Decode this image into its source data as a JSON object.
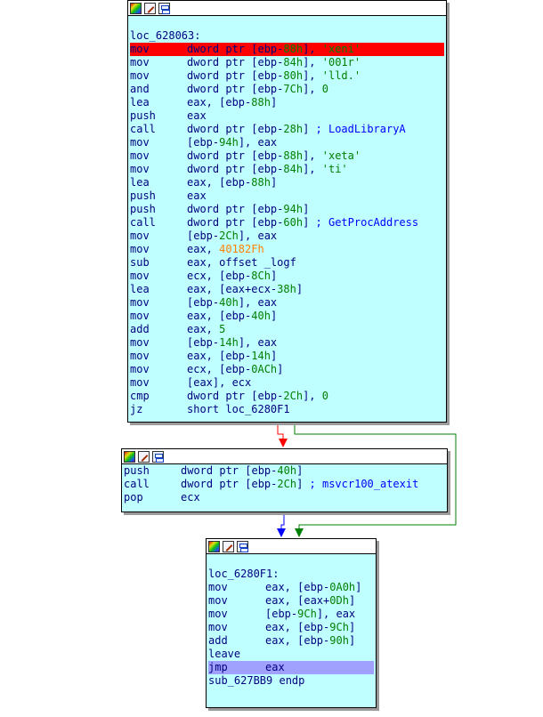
{
  "colors": {
    "node_bg": "#c0ffff",
    "highlight_current": "#ff0000",
    "highlight_selected": "#a0a0ff",
    "edge_true": "#008000",
    "edge_false": "#ff0000",
    "edge_uncond": "#0000ff",
    "immediate": "#ff8000"
  },
  "nodes": [
    {
      "id": "block-1",
      "header_icons": [
        "color-icon",
        "edit-icon",
        "graph-icon"
      ],
      "lines": [
        {
          "kind": "blank"
        },
        {
          "kind": "label",
          "text": "loc_628063:"
        },
        {
          "kind": "ins",
          "hl": "red",
          "mn": "mov",
          "ops": [
            {
              "t": "dword ptr [ebp-",
              "c": "n"
            },
            {
              "t": "88h",
              "c": "var"
            },
            {
              "t": "], ",
              "c": "n"
            },
            {
              "t": "'xeni'",
              "c": "str"
            }
          ]
        },
        {
          "kind": "ins",
          "mn": "mov",
          "ops": [
            {
              "t": "dword ptr [ebp-",
              "c": "n"
            },
            {
              "t": "84h",
              "c": "var"
            },
            {
              "t": "], ",
              "c": "n"
            },
            {
              "t": "'001r'",
              "c": "str"
            }
          ]
        },
        {
          "kind": "ins",
          "mn": "mov",
          "ops": [
            {
              "t": "dword ptr [ebp-",
              "c": "n"
            },
            {
              "t": "80h",
              "c": "var"
            },
            {
              "t": "], ",
              "c": "n"
            },
            {
              "t": "'lld.'",
              "c": "str"
            }
          ]
        },
        {
          "kind": "ins",
          "mn": "and",
          "ops": [
            {
              "t": "dword ptr [ebp-",
              "c": "n"
            },
            {
              "t": "7Ch",
              "c": "var"
            },
            {
              "t": "], ",
              "c": "n"
            },
            {
              "t": "0",
              "c": "num"
            }
          ]
        },
        {
          "kind": "ins",
          "mn": "lea",
          "ops": [
            {
              "t": "eax, [ebp-",
              "c": "n"
            },
            {
              "t": "88h",
              "c": "var"
            },
            {
              "t": "]",
              "c": "n"
            }
          ]
        },
        {
          "kind": "ins",
          "mn": "push",
          "ops": [
            {
              "t": "eax",
              "c": "n"
            }
          ]
        },
        {
          "kind": "ins",
          "mn": "call",
          "ops": [
            {
              "t": "dword ptr [ebp-",
              "c": "n"
            },
            {
              "t": "28h",
              "c": "var"
            },
            {
              "t": "] ",
              "c": "n"
            },
            {
              "t": "; LoadLibraryA",
              "c": "cmt"
            }
          ]
        },
        {
          "kind": "ins",
          "mn": "mov",
          "ops": [
            {
              "t": "[ebp-",
              "c": "n"
            },
            {
              "t": "94h",
              "c": "var"
            },
            {
              "t": "], eax",
              "c": "n"
            }
          ]
        },
        {
          "kind": "ins",
          "mn": "mov",
          "ops": [
            {
              "t": "dword ptr [ebp-",
              "c": "n"
            },
            {
              "t": "88h",
              "c": "var"
            },
            {
              "t": "], ",
              "c": "n"
            },
            {
              "t": "'xeta'",
              "c": "str"
            }
          ]
        },
        {
          "kind": "ins",
          "mn": "mov",
          "ops": [
            {
              "t": "dword ptr [ebp-",
              "c": "n"
            },
            {
              "t": "84h",
              "c": "var"
            },
            {
              "t": "], ",
              "c": "n"
            },
            {
              "t": "'ti'",
              "c": "str"
            }
          ]
        },
        {
          "kind": "ins",
          "mn": "lea",
          "ops": [
            {
              "t": "eax, [ebp-",
              "c": "n"
            },
            {
              "t": "88h",
              "c": "var"
            },
            {
              "t": "]",
              "c": "n"
            }
          ]
        },
        {
          "kind": "ins",
          "mn": "push",
          "ops": [
            {
              "t": "eax",
              "c": "n"
            }
          ]
        },
        {
          "kind": "ins",
          "mn": "push",
          "ops": [
            {
              "t": "dword ptr [ebp-",
              "c": "n"
            },
            {
              "t": "94h",
              "c": "var"
            },
            {
              "t": "]",
              "c": "n"
            }
          ]
        },
        {
          "kind": "ins",
          "mn": "call",
          "ops": [
            {
              "t": "dword ptr [ebp-",
              "c": "n"
            },
            {
              "t": "60h",
              "c": "var"
            },
            {
              "t": "] ",
              "c": "n"
            },
            {
              "t": "; GetProcAddress",
              "c": "cmt"
            }
          ]
        },
        {
          "kind": "ins",
          "mn": "mov",
          "ops": [
            {
              "t": "[ebp-",
              "c": "n"
            },
            {
              "t": "2Ch",
              "c": "var"
            },
            {
              "t": "], eax",
              "c": "n"
            }
          ]
        },
        {
          "kind": "ins",
          "mn": "mov",
          "ops": [
            {
              "t": "eax, ",
              "c": "n"
            },
            {
              "t": "40182Fh",
              "c": "imm"
            }
          ]
        },
        {
          "kind": "ins",
          "mn": "sub",
          "ops": [
            {
              "t": "eax, offset _logf",
              "c": "n"
            }
          ]
        },
        {
          "kind": "ins",
          "mn": "mov",
          "ops": [
            {
              "t": "ecx, [ebp-",
              "c": "n"
            },
            {
              "t": "8Ch",
              "c": "var"
            },
            {
              "t": "]",
              "c": "n"
            }
          ]
        },
        {
          "kind": "ins",
          "mn": "lea",
          "ops": [
            {
              "t": "eax, [eax+ecx-",
              "c": "n"
            },
            {
              "t": "38h",
              "c": "var"
            },
            {
              "t": "]",
              "c": "n"
            }
          ]
        },
        {
          "kind": "ins",
          "mn": "mov",
          "ops": [
            {
              "t": "[ebp-",
              "c": "n"
            },
            {
              "t": "40h",
              "c": "var"
            },
            {
              "t": "], eax",
              "c": "n"
            }
          ]
        },
        {
          "kind": "ins",
          "mn": "mov",
          "ops": [
            {
              "t": "eax, [ebp-",
              "c": "n"
            },
            {
              "t": "40h",
              "c": "var"
            },
            {
              "t": "]",
              "c": "n"
            }
          ]
        },
        {
          "kind": "ins",
          "mn": "add",
          "ops": [
            {
              "t": "eax, ",
              "c": "n"
            },
            {
              "t": "5",
              "c": "num"
            }
          ]
        },
        {
          "kind": "ins",
          "mn": "mov",
          "ops": [
            {
              "t": "[ebp-",
              "c": "n"
            },
            {
              "t": "14h",
              "c": "var"
            },
            {
              "t": "], eax",
              "c": "n"
            }
          ]
        },
        {
          "kind": "ins",
          "mn": "mov",
          "ops": [
            {
              "t": "eax, [ebp-",
              "c": "n"
            },
            {
              "t": "14h",
              "c": "var"
            },
            {
              "t": "]",
              "c": "n"
            }
          ]
        },
        {
          "kind": "ins",
          "mn": "mov",
          "ops": [
            {
              "t": "ecx, [ebp-",
              "c": "n"
            },
            {
              "t": "0ACh",
              "c": "var"
            },
            {
              "t": "]",
              "c": "n"
            }
          ]
        },
        {
          "kind": "ins",
          "mn": "mov",
          "ops": [
            {
              "t": "[eax], ecx",
              "c": "n"
            }
          ]
        },
        {
          "kind": "ins",
          "mn": "cmp",
          "ops": [
            {
              "t": "dword ptr [ebp-",
              "c": "n"
            },
            {
              "t": "2Ch",
              "c": "var"
            },
            {
              "t": "], ",
              "c": "n"
            },
            {
              "t": "0",
              "c": "num"
            }
          ]
        },
        {
          "kind": "ins",
          "mn": "jz",
          "ops": [
            {
              "t": "short loc_6280F1",
              "c": "n"
            }
          ]
        }
      ]
    },
    {
      "id": "block-2",
      "header_icons": [
        "color-icon",
        "edit-icon",
        "graph-icon"
      ],
      "lines": [
        {
          "kind": "ins",
          "mn": "push",
          "ops": [
            {
              "t": "dword ptr [ebp-",
              "c": "n"
            },
            {
              "t": "40h",
              "c": "var"
            },
            {
              "t": "]",
              "c": "n"
            }
          ]
        },
        {
          "kind": "ins",
          "mn": "call",
          "ops": [
            {
              "t": "dword ptr [ebp-",
              "c": "n"
            },
            {
              "t": "2Ch",
              "c": "var"
            },
            {
              "t": "] ",
              "c": "n"
            },
            {
              "t": "; msvcr100_atexit",
              "c": "cmt"
            }
          ]
        },
        {
          "kind": "ins",
          "mn": "pop",
          "ops": [
            {
              "t": "ecx",
              "c": "n"
            }
          ]
        }
      ]
    },
    {
      "id": "block-3",
      "header_icons": [
        "color-icon",
        "edit-icon",
        "graph-icon"
      ],
      "lines": [
        {
          "kind": "blank"
        },
        {
          "kind": "label",
          "text": "loc_6280F1:"
        },
        {
          "kind": "ins",
          "mn": "mov",
          "ops": [
            {
              "t": "eax, [ebp-",
              "c": "n"
            },
            {
              "t": "0A0h",
              "c": "var"
            },
            {
              "t": "]",
              "c": "n"
            }
          ]
        },
        {
          "kind": "ins",
          "mn": "mov",
          "ops": [
            {
              "t": "eax, [eax+",
              "c": "n"
            },
            {
              "t": "0Dh",
              "c": "num"
            },
            {
              "t": "]",
              "c": "n"
            }
          ]
        },
        {
          "kind": "ins",
          "mn": "mov",
          "ops": [
            {
              "t": "[ebp-",
              "c": "n"
            },
            {
              "t": "9Ch",
              "c": "var"
            },
            {
              "t": "], eax",
              "c": "n"
            }
          ]
        },
        {
          "kind": "ins",
          "mn": "mov",
          "ops": [
            {
              "t": "eax, [ebp-",
              "c": "n"
            },
            {
              "t": "9Ch",
              "c": "var"
            },
            {
              "t": "]",
              "c": "n"
            }
          ]
        },
        {
          "kind": "ins",
          "mn": "add",
          "ops": [
            {
              "t": "eax, [ebp-",
              "c": "n"
            },
            {
              "t": "90h",
              "c": "var"
            },
            {
              "t": "]",
              "c": "n"
            }
          ]
        },
        {
          "kind": "ins",
          "mn": "leave",
          "ops": []
        },
        {
          "kind": "ins",
          "hl": "blue",
          "mn": "jmp",
          "ops": [
            {
              "t": "eax",
              "c": "n"
            }
          ]
        },
        {
          "kind": "label",
          "text": "sub_627BB9 endp"
        }
      ]
    }
  ]
}
